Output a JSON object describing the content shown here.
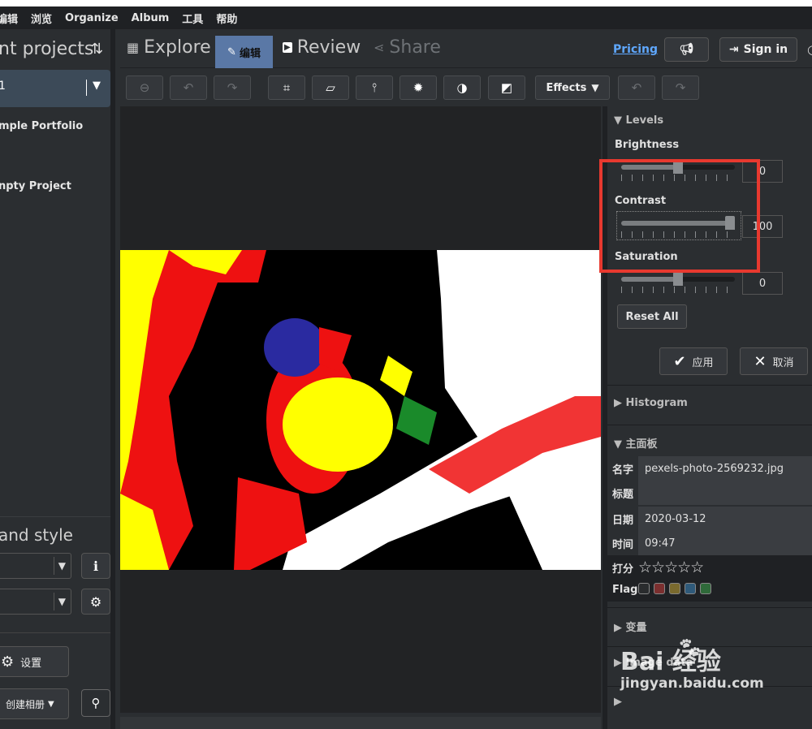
{
  "menu": [
    "编辑",
    "浏览",
    "Organize",
    "Album",
    "工具",
    "帮助"
  ],
  "left": {
    "title": "nt projects",
    "project_value": "1",
    "projects": [
      "mple Portfolio",
      "npty Project"
    ],
    "section2_title": "and style",
    "settings_label": "设置",
    "album_label": "创建相册"
  },
  "tabs": {
    "explore": "Explore",
    "edit": "编辑",
    "review": "Review",
    "share": "Share",
    "pricing": "Pricing",
    "signin": "Sign in"
  },
  "toolbar": {
    "effects": "Effects"
  },
  "levels": {
    "title": "Levels",
    "sliders": [
      {
        "label": "Brightness",
        "value": "0",
        "pct": 0.5
      },
      {
        "label": "Contrast",
        "value": "100",
        "pct": 1.0
      },
      {
        "label": "Saturation",
        "value": "0",
        "pct": 0.5
      }
    ],
    "reset": "Reset All",
    "apply": "应用",
    "cancel": "取消"
  },
  "sections": {
    "histogram": "Histogram",
    "main_panel": "主面板",
    "variables": "变量",
    "image_data": "Image data"
  },
  "meta": {
    "name_key": "名字",
    "name_val": "pexels-photo-2569232.jpg",
    "title_key": "标题",
    "title_val": "",
    "date_key": "日期",
    "date_val": "2020-03-12",
    "time_key": "时间",
    "time_val": "09:47",
    "rating_key": "打分",
    "rating": 0,
    "flag_key": "Flag",
    "flag_colors": [
      "#2a2c2e",
      "#7b2f2f",
      "#7a6a2e",
      "#2f5a7a",
      "#2f6a3a"
    ]
  },
  "watermark": {
    "brand": "Bai  经验",
    "url": "jingyan.baidu.com"
  },
  "colors": {
    "accent": "#5a78a6",
    "highlight": "#e8392f",
    "link": "#5fa8ff"
  }
}
